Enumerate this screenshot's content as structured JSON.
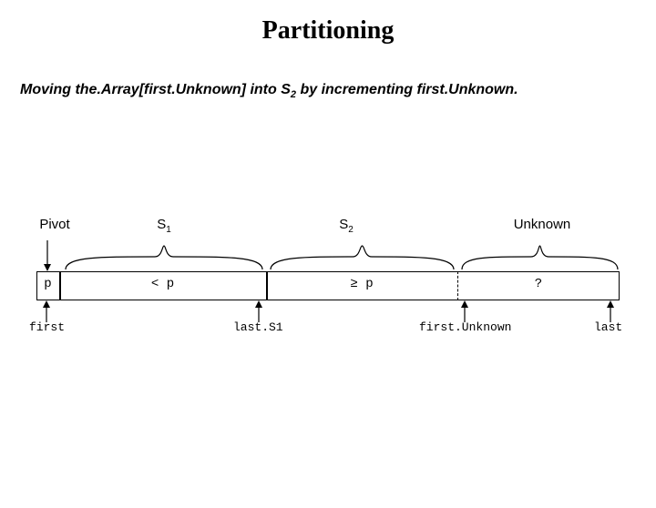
{
  "title": "Partitioning",
  "subtitle_pre": "Moving the.Array[first.Unknown] into S",
  "subtitle_sub": "2",
  "subtitle_post": " by incrementing first.Unknown.",
  "regions": {
    "pivot_label": "Pivot",
    "s1_label_pre": "S",
    "s1_label_sub": "1",
    "s2_label_pre": "S",
    "s2_label_sub": "2",
    "unknown_label": "Unknown"
  },
  "cells": {
    "pivot": "p",
    "s1": "< p",
    "s2": "≥ p",
    "unknown": "?"
  },
  "pointers": {
    "first": "first",
    "lastS1": "last.S1",
    "firstUnknown": "first.Unknown",
    "last": "last"
  }
}
